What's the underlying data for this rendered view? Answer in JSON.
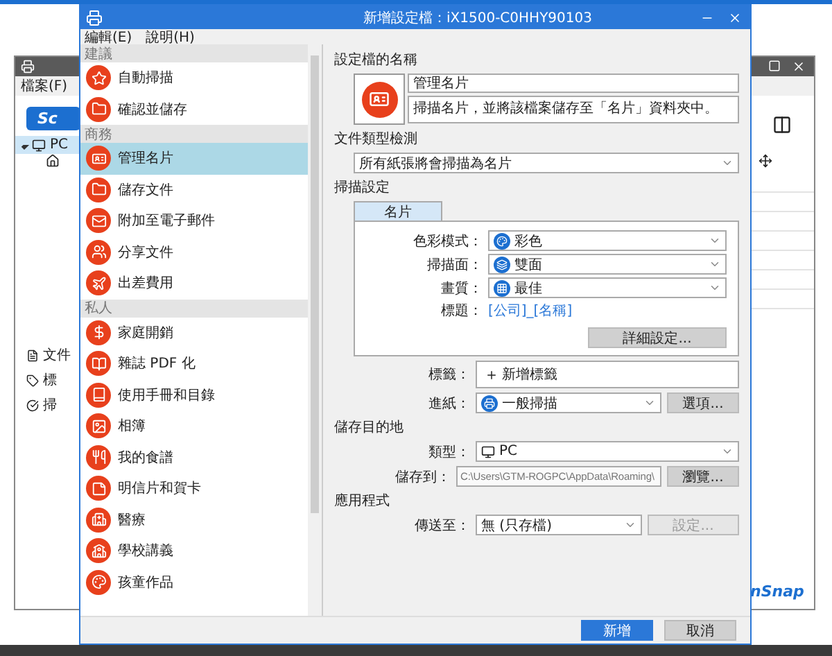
{
  "background_window": {
    "menu": [
      "檔案(F)"
    ],
    "logo": "Sc",
    "tree": [
      {
        "label": "PC",
        "selected": true,
        "expanded": true
      }
    ],
    "side_items": [
      "文件",
      "標",
      "掃"
    ],
    "brand": "nSnap"
  },
  "dialog": {
    "title": "新增設定檔：iX1500-C0HHY90103",
    "menu": [
      "編輯(E)",
      "說明(H)"
    ],
    "profile_groups": [
      {
        "header": "建議",
        "items": [
          {
            "label": "自動掃描",
            "selected": false
          },
          {
            "label": "確認並儲存",
            "selected": false
          }
        ]
      },
      {
        "header": "商務",
        "items": [
          {
            "label": "管理名片",
            "selected": true
          },
          {
            "label": "儲存文件",
            "selected": false
          },
          {
            "label": "附加至電子郵件",
            "selected": false
          },
          {
            "label": "分享文件",
            "selected": false
          },
          {
            "label": "出差費用",
            "selected": false
          }
        ]
      },
      {
        "header": "私人",
        "items": [
          {
            "label": "家庭開銷",
            "selected": false
          },
          {
            "label": "雜誌 PDF 化",
            "selected": false
          },
          {
            "label": "使用手冊和目錄",
            "selected": false
          },
          {
            "label": "相簿",
            "selected": false
          },
          {
            "label": "我的食譜",
            "selected": false
          },
          {
            "label": "明信片和賀卡",
            "selected": false
          },
          {
            "label": "醫療",
            "selected": false
          },
          {
            "label": "學校講義",
            "selected": false
          },
          {
            "label": "孩童作品",
            "selected": false
          }
        ]
      }
    ],
    "profile_name": {
      "label": "設定檔的名稱",
      "name": "管理名片",
      "description": "掃描名片，並將該檔案儲存至「名片」資料夾中。"
    },
    "doc_type": {
      "label": "文件類型檢測",
      "value": "所有紙張將會掃描為名片"
    },
    "scan_settings": {
      "label": "掃描設定",
      "tabs": [
        {
          "label": "名片",
          "selected": true
        }
      ],
      "rows": [
        {
          "label": "色彩模式：",
          "value": "彩色"
        },
        {
          "label": "掃描面：",
          "value": "雙面"
        },
        {
          "label": "畫質：",
          "value": "最佳"
        }
      ],
      "title_label": "標題：",
      "title_value": "[公司]_[名稱]",
      "detail_button": "詳細設定..."
    },
    "tags": {
      "label": "標籤：",
      "value": "新增標籤"
    },
    "feed": {
      "label": "進紙：",
      "value": "一般掃描",
      "button": "選項..."
    },
    "destination": {
      "label": "儲存目的地",
      "type_label": "類型：",
      "type_value": "PC",
      "path_label": "儲存到：",
      "path_value": "C:\\Users\\GTM-ROGPC\\AppData\\Roaming\\",
      "button": "瀏覽..."
    },
    "application": {
      "label": "應用程式",
      "send_label": "傳送至：",
      "send_value": "無 (只存檔)",
      "button": "設定...",
      "button_disabled": true
    },
    "buttons": [
      {
        "label": "新增",
        "kind": "primary"
      },
      {
        "label": "取消",
        "kind": "normal"
      }
    ]
  }
}
